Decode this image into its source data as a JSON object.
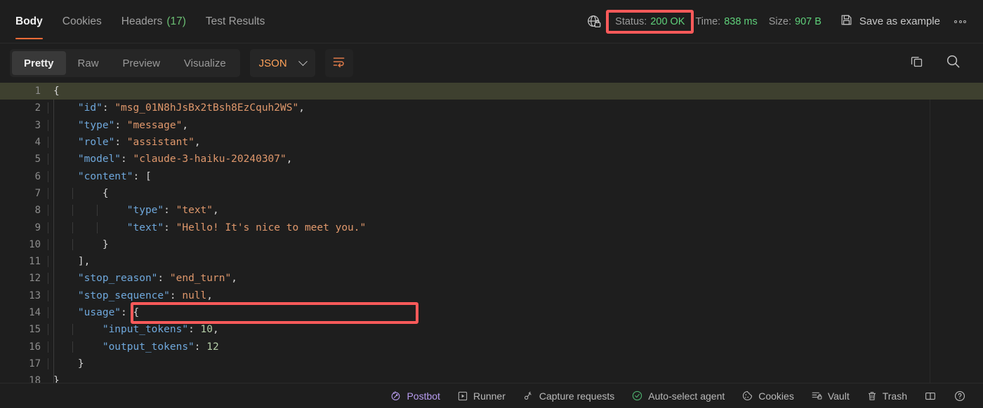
{
  "response_tabs": [
    {
      "label": "Body",
      "active": true,
      "count": ""
    },
    {
      "label": "Cookies",
      "active": false,
      "count": ""
    },
    {
      "label": "Headers",
      "active": false,
      "count": "(17)"
    },
    {
      "label": "Test Results",
      "active": false,
      "count": ""
    }
  ],
  "meta": {
    "connection_icon": "globe-lock-icon",
    "status_label": "Status:",
    "status_value": "200 OK",
    "time_label": "Time:",
    "time_value": "838 ms",
    "size_label": "Size:",
    "size_value": "907 B",
    "save_example_label": "Save as example",
    "save_icon": "floppy-disk-icon",
    "more_icon": "more-horizontal-icon"
  },
  "format_bar": {
    "segments": [
      {
        "label": "Pretty",
        "active": true
      },
      {
        "label": "Raw",
        "active": false
      },
      {
        "label": "Preview",
        "active": false
      },
      {
        "label": "Visualize",
        "active": false
      }
    ],
    "language": "JSON",
    "wrap_icon": "word-wrap-icon",
    "copy_icon": "copy-icon",
    "search_icon": "search-icon"
  },
  "code": {
    "lines": [
      {
        "no": "1",
        "highlight": true,
        "indent": 0,
        "tokens": [
          {
            "t": "{",
            "c": "p"
          }
        ]
      },
      {
        "no": "2",
        "highlight": false,
        "indent": 1,
        "tokens": [
          {
            "t": "    ",
            "c": "p"
          },
          {
            "t": "\"id\"",
            "c": "k"
          },
          {
            "t": ": ",
            "c": "p"
          },
          {
            "t": "\"msg_01N8hJsBx2tBsh8EzCquh2WS\"",
            "c": "s"
          },
          {
            "t": ",",
            "c": "p"
          }
        ]
      },
      {
        "no": "3",
        "highlight": false,
        "indent": 1,
        "tokens": [
          {
            "t": "    ",
            "c": "p"
          },
          {
            "t": "\"type\"",
            "c": "k"
          },
          {
            "t": ": ",
            "c": "p"
          },
          {
            "t": "\"message\"",
            "c": "s"
          },
          {
            "t": ",",
            "c": "p"
          }
        ]
      },
      {
        "no": "4",
        "highlight": false,
        "indent": 1,
        "tokens": [
          {
            "t": "    ",
            "c": "p"
          },
          {
            "t": "\"role\"",
            "c": "k"
          },
          {
            "t": ": ",
            "c": "p"
          },
          {
            "t": "\"assistant\"",
            "c": "s"
          },
          {
            "t": ",",
            "c": "p"
          }
        ]
      },
      {
        "no": "5",
        "highlight": false,
        "indent": 1,
        "tokens": [
          {
            "t": "    ",
            "c": "p"
          },
          {
            "t": "\"model\"",
            "c": "k"
          },
          {
            "t": ": ",
            "c": "p"
          },
          {
            "t": "\"claude-3-haiku-20240307\"",
            "c": "s"
          },
          {
            "t": ",",
            "c": "p"
          }
        ]
      },
      {
        "no": "6",
        "highlight": false,
        "indent": 1,
        "tokens": [
          {
            "t": "    ",
            "c": "p"
          },
          {
            "t": "\"content\"",
            "c": "k"
          },
          {
            "t": ": [",
            "c": "p"
          }
        ]
      },
      {
        "no": "7",
        "highlight": false,
        "indent": 2,
        "tokens": [
          {
            "t": "        {",
            "c": "p"
          }
        ]
      },
      {
        "no": "8",
        "highlight": false,
        "indent": 3,
        "tokens": [
          {
            "t": "            ",
            "c": "p"
          },
          {
            "t": "\"type\"",
            "c": "k"
          },
          {
            "t": ": ",
            "c": "p"
          },
          {
            "t": "\"text\"",
            "c": "s"
          },
          {
            "t": ",",
            "c": "p"
          }
        ]
      },
      {
        "no": "9",
        "highlight": false,
        "indent": 3,
        "tokens": [
          {
            "t": "            ",
            "c": "p"
          },
          {
            "t": "\"text\"",
            "c": "k"
          },
          {
            "t": ": ",
            "c": "p"
          },
          {
            "t": "\"Hello! It's nice to meet you.\"",
            "c": "s"
          }
        ]
      },
      {
        "no": "10",
        "highlight": false,
        "indent": 2,
        "tokens": [
          {
            "t": "        }",
            "c": "p"
          }
        ]
      },
      {
        "no": "11",
        "highlight": false,
        "indent": 1,
        "tokens": [
          {
            "t": "    ],",
            "c": "p"
          }
        ]
      },
      {
        "no": "12",
        "highlight": false,
        "indent": 1,
        "tokens": [
          {
            "t": "    ",
            "c": "p"
          },
          {
            "t": "\"stop_reason\"",
            "c": "k"
          },
          {
            "t": ": ",
            "c": "p"
          },
          {
            "t": "\"end_turn\"",
            "c": "s"
          },
          {
            "t": ",",
            "c": "p"
          }
        ]
      },
      {
        "no": "13",
        "highlight": false,
        "indent": 1,
        "tokens": [
          {
            "t": "    ",
            "c": "p"
          },
          {
            "t": "\"stop_sequence\"",
            "c": "k"
          },
          {
            "t": ": ",
            "c": "p"
          },
          {
            "t": "null",
            "c": "s"
          },
          {
            "t": ",",
            "c": "p"
          }
        ]
      },
      {
        "no": "14",
        "highlight": false,
        "indent": 1,
        "tokens": [
          {
            "t": "    ",
            "c": "p"
          },
          {
            "t": "\"usage\"",
            "c": "k"
          },
          {
            "t": ": {",
            "c": "p"
          }
        ]
      },
      {
        "no": "15",
        "highlight": false,
        "indent": 2,
        "tokens": [
          {
            "t": "        ",
            "c": "p"
          },
          {
            "t": "\"input_tokens\"",
            "c": "k"
          },
          {
            "t": ": ",
            "c": "p"
          },
          {
            "t": "10",
            "c": "n"
          },
          {
            "t": ",",
            "c": "p"
          }
        ]
      },
      {
        "no": "16",
        "highlight": false,
        "indent": 2,
        "tokens": [
          {
            "t": "        ",
            "c": "p"
          },
          {
            "t": "\"output_tokens\"",
            "c": "k"
          },
          {
            "t": ": ",
            "c": "p"
          },
          {
            "t": "12",
            "c": "n"
          }
        ]
      },
      {
        "no": "17",
        "highlight": false,
        "indent": 1,
        "tokens": [
          {
            "t": "    }",
            "c": "p"
          }
        ]
      },
      {
        "no": "18",
        "highlight": false,
        "indent": 0,
        "tokens": [
          {
            "t": "}",
            "c": "p"
          }
        ]
      }
    ]
  },
  "statusbar": {
    "items": [
      {
        "label": "Postbot",
        "icon": "postbot-icon"
      },
      {
        "label": "Runner",
        "icon": "runner-icon"
      },
      {
        "label": "Capture requests",
        "icon": "capture-icon"
      },
      {
        "label": "Auto-select agent",
        "icon": "check-circle-icon"
      },
      {
        "label": "Cookies",
        "icon": "cookie-icon"
      },
      {
        "label": "Vault",
        "icon": "vault-icon"
      },
      {
        "label": "Trash",
        "icon": "trash-icon"
      }
    ],
    "layout_icon": "panel-layout-icon",
    "help_icon": "help-circle-icon"
  },
  "colors": {
    "accent": "#ff6c37",
    "success": "#5fd07a",
    "highlight_box": "#fc5a5a",
    "key": "#6fa8dc",
    "string": "#e0986c",
    "number": "#b5cea8"
  }
}
